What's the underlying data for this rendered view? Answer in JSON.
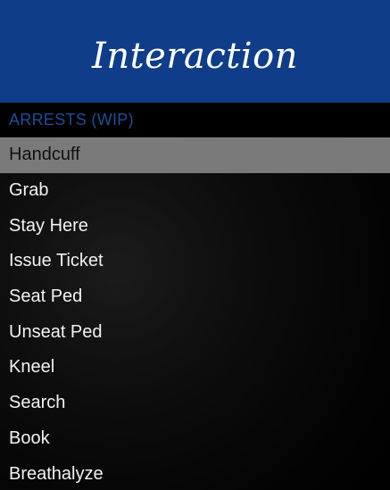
{
  "menu": {
    "title": "Interaction",
    "subtitle": "ARRESTS (WIP)",
    "selected_index": 0,
    "items": [
      {
        "label": "Handcuff"
      },
      {
        "label": "Grab"
      },
      {
        "label": "Stay Here"
      },
      {
        "label": "Issue Ticket"
      },
      {
        "label": "Seat Ped"
      },
      {
        "label": "Unseat Ped"
      },
      {
        "label": "Kneel"
      },
      {
        "label": "Search"
      },
      {
        "label": "Book"
      },
      {
        "label": "Breathalyze"
      }
    ]
  },
  "colors": {
    "banner": "#0f3d8a",
    "subtitle": "#1e4f9c",
    "selected_bg": "#7a7a7a"
  }
}
